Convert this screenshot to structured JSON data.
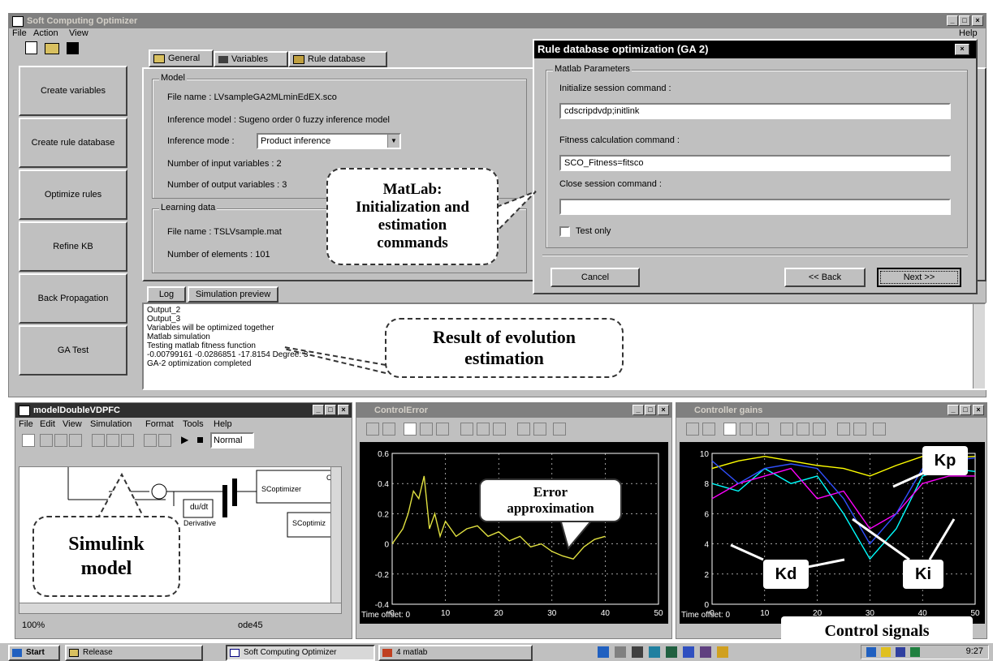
{
  "main_window": {
    "title": "Soft Computing Optimizer",
    "help": "Help",
    "menu": [
      "File",
      "Action",
      "View"
    ],
    "tabs": [
      "General",
      "Variables",
      "Rule database"
    ],
    "sidebar_buttons": [
      "Create variables",
      "Create rule database",
      "Optimize rules",
      "Refine KB",
      "Back Propagation",
      "GA Test"
    ],
    "model": {
      "group_label": "Model",
      "file_name": "File name : LVsampleGA2MLminEdEX.sco",
      "inference_model": "Inference model :   Sugeno order 0 fuzzy inference model",
      "inference_mode_label": "Inference mode :",
      "inference_mode_value": "Product inference",
      "num_inputs": "Number of input variables : 2",
      "num_outputs": "Number of output variables : 3"
    },
    "learning": {
      "group_label": "Learning data",
      "file_name": "File name : TSLVsample.mat",
      "num_elements": "Number of elements : 101"
    },
    "log_tabs": [
      "Log",
      "Simulation preview"
    ],
    "log_lines": [
      "Output_2",
      "Output_3",
      "Variables will be optimized together",
      "Matlab simulation",
      "Testing matlab fitness function",
      "-0.00799161 -0.0286851 -17.8154 Degree: 3",
      "GA-2 optimization completed"
    ]
  },
  "dialog": {
    "title": "Rule database optimization (GA 2)",
    "group_label": "Matlab Parameters",
    "init_label": "Initialize session command :",
    "init_value": "cdscripdvdp;initlink",
    "fitness_label": "Fitness calculation command :",
    "fitness_value": "SCO_Fitness=fitsco",
    "close_label": "Close session command :",
    "close_value": "",
    "test_only": "Test only",
    "cancel": "Cancel",
    "back": "<< Back",
    "next": "Next >>"
  },
  "simulink": {
    "title": "modelDoubleVDPFC",
    "menu": [
      "File",
      "Edit",
      "View",
      "Simulation",
      "Format",
      "Tools",
      "Help"
    ],
    "mode": "Normal",
    "blocks": [
      "SCoptimizer",
      "SCoptimiz",
      "du/dt",
      "Derivative",
      "C-"
    ],
    "status": [
      "100%",
      "ode45"
    ]
  },
  "error_window": {
    "title": "ControlError",
    "time_offset": "Time offset:  0",
    "y_ticks": [
      "0.6",
      "0.4",
      "0.2",
      "0",
      "-0.2",
      "-0.4"
    ],
    "x_ticks": [
      "0",
      "10",
      "20",
      "30",
      "40",
      "50"
    ]
  },
  "gains_window": {
    "title": "Controller gains",
    "time_offset": "Time offset:  0",
    "y_ticks": [
      "10",
      "8",
      "6",
      "4",
      "2",
      "0"
    ],
    "x_ticks": [
      "0",
      "10",
      "20",
      "30",
      "40",
      "50"
    ]
  },
  "callouts": {
    "matlab": [
      "MatLab:",
      "Initialization and",
      "estimation",
      "commands"
    ],
    "result": [
      "Result of evolution",
      "estimation"
    ],
    "error": [
      "Error",
      "approximation"
    ],
    "simulink": [
      "Simulink",
      "model"
    ],
    "kp": "Kp",
    "kd": "Kd",
    "ki": "Ki",
    "control": "Control signals"
  },
  "taskbar": {
    "start": "Start",
    "items": [
      "Release",
      "Soft Computing Optimizer",
      "4 matlab"
    ],
    "clock": "9:27"
  },
  "chart_data": [
    {
      "type": "line",
      "xlim": [
        0,
        50
      ],
      "ylim": [
        -0.4,
        0.6
      ],
      "series": [
        {
          "color": "#e0e040",
          "x": [
            0,
            1,
            2,
            3,
            4,
            5,
            6,
            7,
            8,
            9,
            10,
            12,
            14,
            16,
            18,
            20,
            22,
            24,
            26,
            28,
            30,
            32,
            34,
            36,
            38,
            40
          ],
          "y": [
            0,
            0.05,
            0.1,
            0.2,
            0.35,
            0.3,
            0.45,
            0.1,
            0.2,
            0.05,
            0.15,
            0.05,
            0.1,
            0.12,
            0.05,
            0.08,
            0.02,
            0.05,
            -0.02,
            0.0,
            -0.05,
            -0.08,
            -0.1,
            -0.02,
            0.03,
            0.05
          ]
        }
      ]
    },
    {
      "type": "line",
      "xlim": [
        0,
        50
      ],
      "ylim": [
        0,
        10
      ],
      "series": [
        {
          "color": "#ffff00",
          "x": [
            0,
            5,
            10,
            15,
            20,
            25,
            30,
            35,
            40,
            45,
            50
          ],
          "y": [
            9,
            9.5,
            9.8,
            9.5,
            9.2,
            9,
            8.5,
            9.2,
            9.8,
            9.7,
            9.8
          ]
        },
        {
          "color": "#00ffff",
          "x": [
            0,
            5,
            10,
            15,
            20,
            25,
            30,
            35,
            40,
            45,
            50
          ],
          "y": [
            8,
            7.5,
            9,
            8,
            8.5,
            6,
            3,
            5,
            8.5,
            9,
            8.8
          ]
        },
        {
          "color": "#ff00ff",
          "x": [
            0,
            5,
            10,
            15,
            20,
            25,
            30,
            35,
            40,
            45,
            50
          ],
          "y": [
            7,
            8,
            8.5,
            9,
            7,
            7.5,
            5,
            6,
            8,
            8.5,
            8.5
          ]
        },
        {
          "color": "#3050ff",
          "x": [
            0,
            5,
            10,
            15,
            20,
            25,
            30,
            35,
            40,
            45,
            50
          ],
          "y": [
            9.5,
            8,
            9,
            9.3,
            9,
            7,
            4,
            6,
            9,
            9.5,
            9.7
          ]
        }
      ]
    }
  ]
}
